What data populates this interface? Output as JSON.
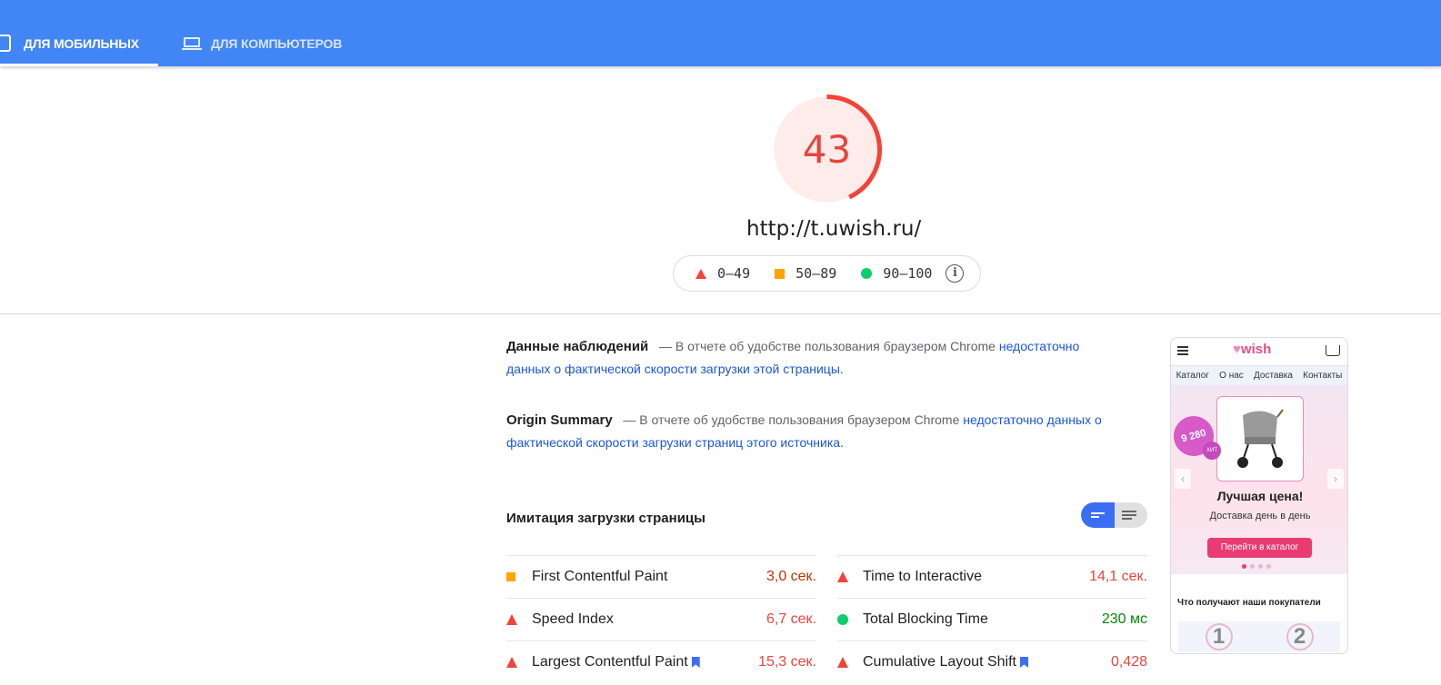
{
  "tabs": {
    "mobile": "ДЛЯ МОБИЛЬНЫХ",
    "desktop": "ДЛЯ КОМПЬЮТЕРОВ"
  },
  "score": {
    "value": "43",
    "fraction": 0.43,
    "color": "#f44336"
  },
  "url": "http://t.uwish.ru/",
  "legend": {
    "fail": "0–49",
    "average": "50–89",
    "pass": "90–100"
  },
  "field_data": {
    "title": "Данные наблюдений",
    "text": "— В отчете об удобстве пользования браузером Chrome",
    "link": "недостаточно данных о фактической скорости загрузки этой страницы."
  },
  "origin_summary": {
    "title": "Origin Summary",
    "text": "— В отчете об удобстве пользования браузером Chrome",
    "link": "недостаточно данных о фактической скорости загрузки страниц этого источника."
  },
  "lab": {
    "title": "Имитация загрузки страницы"
  },
  "metrics": [
    {
      "name": "First Contentful Paint",
      "value": "3,0 сек.",
      "status": "average"
    },
    {
      "name": "Time to Interactive",
      "value": "14,1 сек.",
      "status": "fail"
    },
    {
      "name": "Speed Index",
      "value": "6,7 сек.",
      "status": "fail"
    },
    {
      "name": "Total Blocking Time",
      "value": "230 мс",
      "status": "pass"
    },
    {
      "name": "Largest Contentful Paint",
      "value": "15,3 сек.",
      "status": "fail"
    },
    {
      "name": "Cumulative Layout Shift",
      "value": "0,428",
      "status": "fail"
    }
  ],
  "screenshot": {
    "logo": "wish",
    "nav": [
      "Каталог",
      "О нас",
      "Доставка",
      "Контакты"
    ],
    "badge": "9 280",
    "badge_small": "ХИТ",
    "hero_title": "Лучшая цена!",
    "hero_sub": "Доставка день в день",
    "hero_button": "Перейти в каталог",
    "features_title": "Что получают наши покупатели",
    "numbers": [
      "1",
      "2"
    ]
  }
}
